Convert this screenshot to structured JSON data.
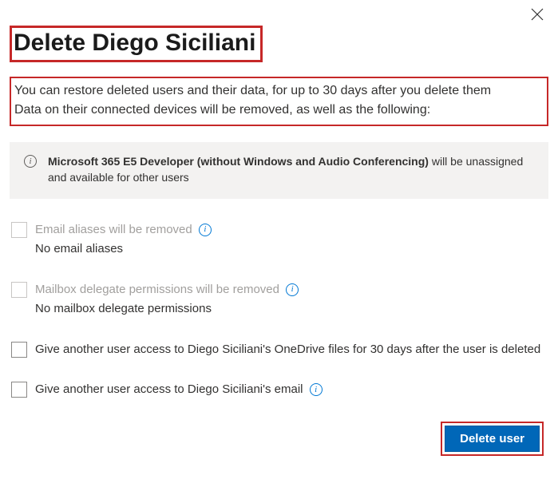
{
  "title": "Delete Diego Siciliani",
  "description_line1": "You can restore deleted users and their data, for up to 30 days after you delete them",
  "description_line2": "Data on their connected devices will be removed, as well as the following:",
  "license": {
    "bold": "Microsoft 365 E5 Developer (without Windows and Audio Conferencing)",
    "tail": " will be unassigned and available for other users"
  },
  "options": {
    "aliases": {
      "label": "Email aliases will be removed",
      "sub": "No email aliases"
    },
    "delegate": {
      "label": "Mailbox delegate permissions will be removed",
      "sub": "No mailbox delegate permissions"
    },
    "onedrive": {
      "label": "Give another user access to Diego Siciliani's OneDrive files for 30 days after the user is deleted"
    },
    "email": {
      "label": "Give another user access to Diego Siciliani's email"
    }
  },
  "buttons": {
    "delete": "Delete user"
  },
  "icons": {
    "info_glyph": "i"
  }
}
